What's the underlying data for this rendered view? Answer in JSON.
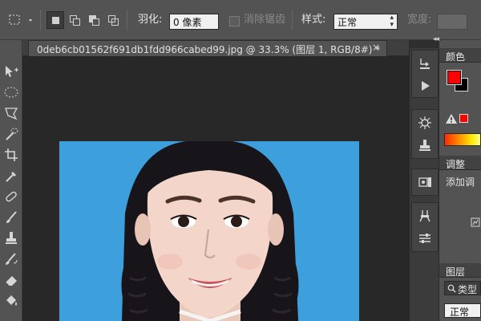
{
  "options_bar": {
    "feather_label": "羽化:",
    "feather_value": "0 像素",
    "antialias_label": "消除锯齿",
    "style_label": "样式:",
    "style_value": "正常",
    "width_label": "宽度:"
  },
  "document": {
    "tab_title": "0deb6cb01562f691db1fdd966cabed99.jpg @ 33.3% (图层 1, RGB/8#) *",
    "close_glyph": "×"
  },
  "panels": {
    "color_tab": "颜色",
    "adjustments_tab": "调整",
    "adjustments_label": "添加调",
    "layers_tab": "图层",
    "layers_search_label": "类型",
    "layers_blend_mode": "正常"
  },
  "colors": {
    "foreground": "#ff0000",
    "background": "#000000",
    "photo_background": "#3da0dc"
  },
  "icons": {
    "tools": [
      "move-icon",
      "elliptical-marquee-icon",
      "lasso-icon",
      "quick-selection-icon",
      "crop-icon",
      "eyedropper-icon",
      "healing-brush-icon",
      "brush-icon",
      "clone-stamp-icon",
      "history-brush-icon",
      "eraser-icon",
      "paint-bucket-icon"
    ],
    "dock": [
      "history-icon",
      "actions-play-icon",
      "brush-settings-icon",
      "clone-source-icon",
      "layer-comps-icon",
      "tool-presets-icon",
      "properties-icon"
    ]
  }
}
